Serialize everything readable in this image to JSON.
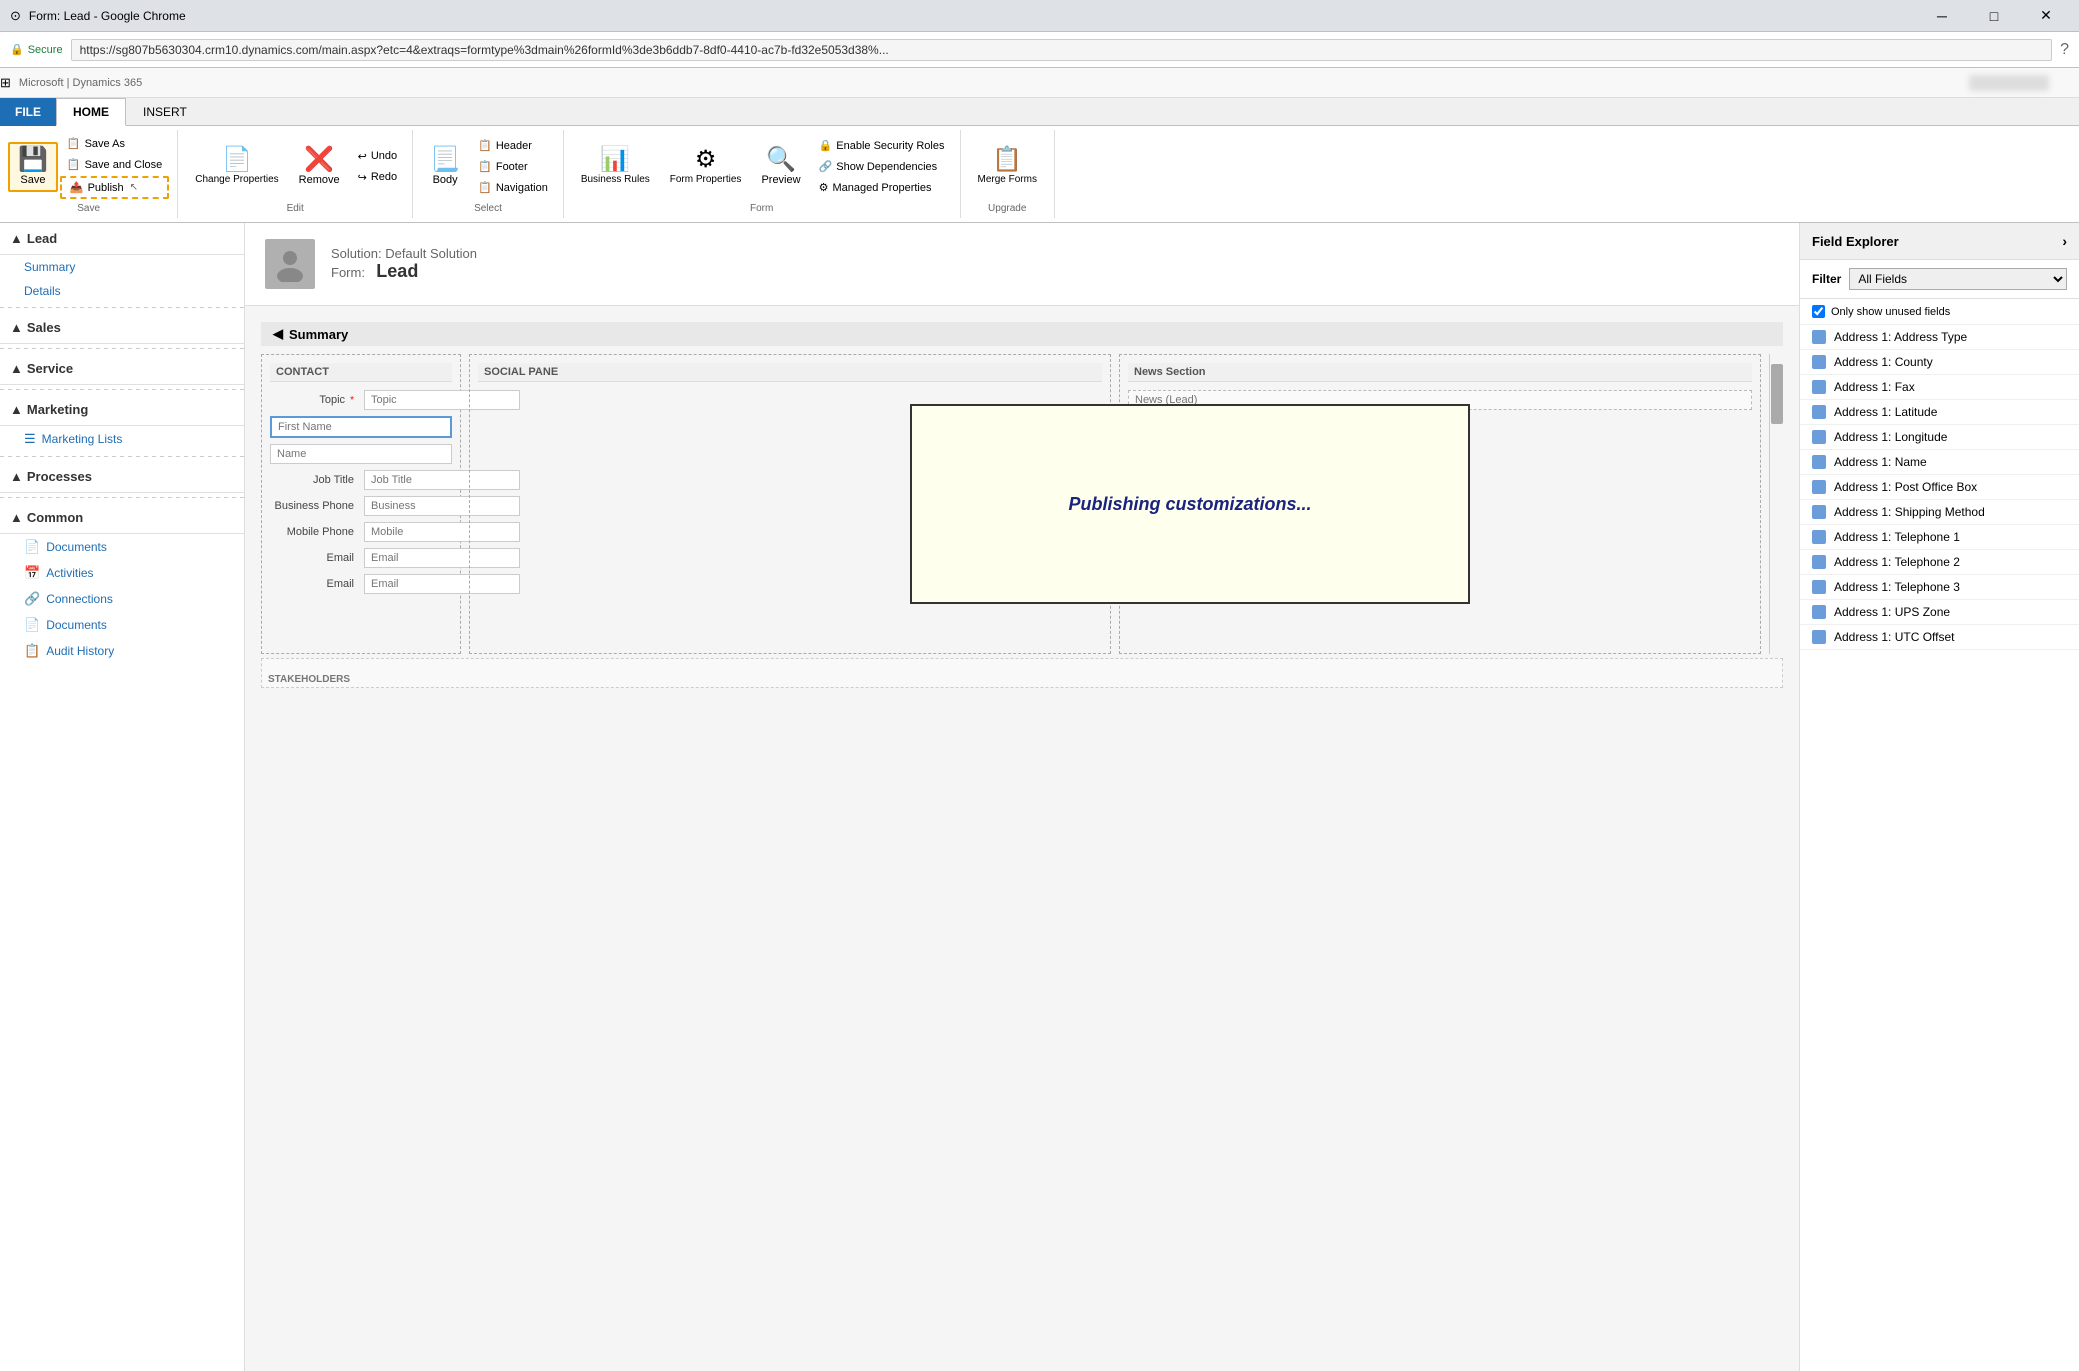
{
  "browser": {
    "title": "Form: Lead - Google Chrome",
    "url": "https://sg807b5630304.crm10.dynamics.com/main.aspx?etc=4&extraqs=formtype%3dmain%26formId%3de3b6ddb7-8df0-4410-ac7b-fd32e5053d38%...",
    "secure_label": "Secure",
    "minimize": "─",
    "maximize": "□",
    "close": "✕"
  },
  "dynamics": {
    "brand": "Microsoft  |  Dynamics 365"
  },
  "ribbon": {
    "tabs": [
      "FILE",
      "HOME",
      "INSERT"
    ],
    "active_tab": "HOME",
    "groups": {
      "save": {
        "label": "Save",
        "save_label": "Save",
        "save_as_label": "Save As",
        "save_close_label": "Save and Close",
        "publish_label": "Publish"
      },
      "edit": {
        "label": "Edit",
        "change_properties": "Change Properties",
        "remove": "Remove",
        "undo": "Undo",
        "redo": "Redo"
      },
      "select": {
        "label": "Select",
        "body": "Body",
        "header": "Header",
        "footer": "Footer",
        "navigation": "Navigation"
      },
      "form": {
        "label": "Form",
        "business_rules": "Business Rules",
        "form_properties": "Form Properties",
        "preview": "Preview",
        "enable_security": "Enable Security Roles",
        "show_dependencies": "Show Dependencies",
        "managed_properties": "Managed Properties"
      },
      "upgrade": {
        "label": "Upgrade",
        "merge_forms": "Merge Forms"
      }
    }
  },
  "sidebar": {
    "sections": [
      {
        "name": "Lead",
        "items": [
          "Summary",
          "Details"
        ]
      },
      {
        "name": "Sales",
        "items": []
      },
      {
        "name": "Service",
        "items": []
      },
      {
        "name": "Marketing",
        "items": [
          "Marketing Lists"
        ]
      },
      {
        "name": "Processes",
        "items": []
      },
      {
        "name": "Common",
        "items": [
          "Documents",
          "Activities",
          "Connections",
          "Documents",
          "Audit History"
        ]
      }
    ]
  },
  "form": {
    "solution": "Solution: Default Solution",
    "form_label": "Form:",
    "form_name": "Lead",
    "section_title": "Summary",
    "columns": [
      {
        "header": "CONTACT",
        "fields": [
          {
            "label": "Topic",
            "placeholder": "Topic",
            "required": true
          },
          {
            "label": "",
            "placeholder": "First Name",
            "highlighted": true
          },
          {
            "label": "",
            "placeholder": "Name"
          },
          {
            "label": "Job Title",
            "placeholder": "Job Title"
          },
          {
            "label": "Business Phone",
            "placeholder": "Business"
          },
          {
            "label": "Mobile Phone",
            "placeholder": "Mobile"
          },
          {
            "label": "Email",
            "placeholder": "Email"
          },
          {
            "label": "Email",
            "placeholder": "Email"
          }
        ]
      },
      {
        "header": "SOCIAL PANE",
        "fields": []
      },
      {
        "header": "News Section",
        "fields": [
          {
            "label": "",
            "placeholder": "News (Lead)"
          }
        ]
      }
    ]
  },
  "publishing": {
    "message": "Publishing customizations..."
  },
  "field_explorer": {
    "title": "Field Explorer",
    "filter_label": "Filter",
    "filter_value": "All Fields",
    "checkbox_label": "Only show unused fields",
    "fields": [
      "Address 1: Address Type",
      "Address 1: County",
      "Address 1: Fax",
      "Address 1: Latitude",
      "Address 1: Longitude",
      "Address 1: Name",
      "Address 1: Post Office Box",
      "Address 1: Shipping Method",
      "Address 1: Telephone 1",
      "Address 1: Telephone 2",
      "Address 1: Telephone 3",
      "Address 1: UPS Zone",
      "Address 1: UTC Offset"
    ]
  }
}
